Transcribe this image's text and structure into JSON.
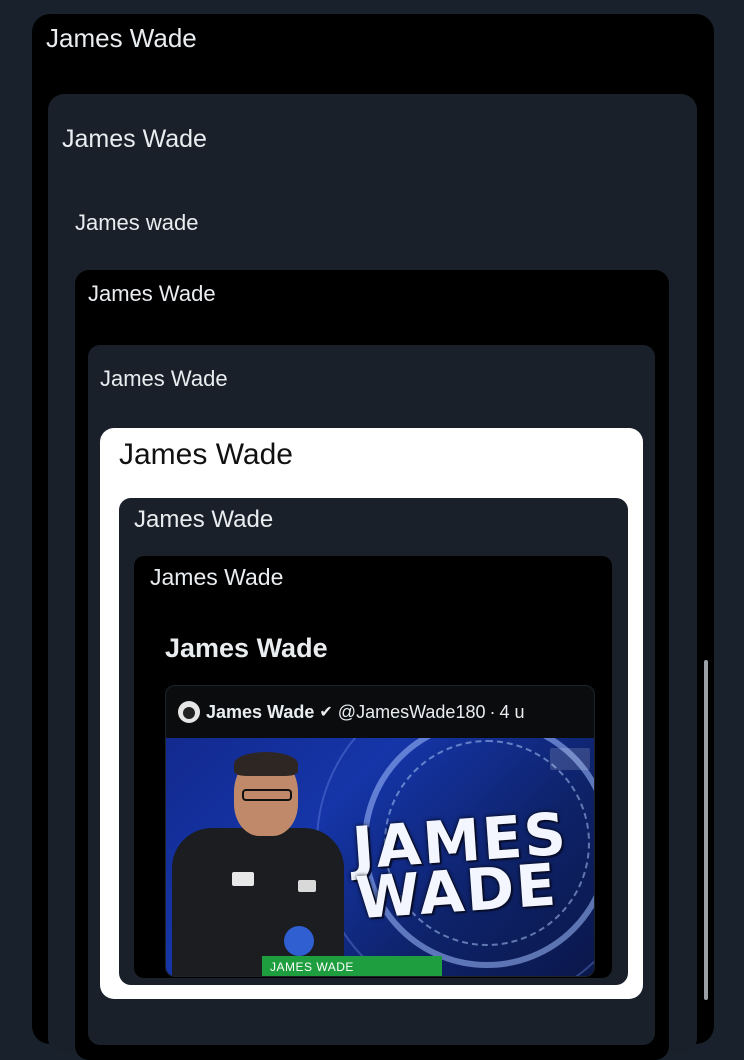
{
  "thread": {
    "level1": {
      "name": "James Wade"
    },
    "level2": {
      "name": "James Wade",
      "text": "James wade"
    },
    "level3": {
      "name": "James Wade"
    },
    "level4": {
      "name": "James Wade"
    },
    "level5": {
      "name": "James Wade"
    },
    "level6": {
      "name": "James Wade"
    },
    "level7": {
      "name": "James Wade",
      "text": "James Wade"
    },
    "embedded_tweet": {
      "avatar_icon": "avatar",
      "display_name": "James Wade",
      "verified_icon": "verified-badge-icon",
      "verified_glyph": "✔",
      "handle": "@JamesWade180",
      "separator": "·",
      "time": "4 u",
      "media": {
        "logo_text": "JAMES\nWADE",
        "lower_third": "JAMES WADE"
      }
    }
  },
  "colors": {
    "page_bg": "#19222c",
    "dark_card": "#000000",
    "mid_card": "#192029",
    "white_card": "#ffffff",
    "lower_third_green": "#1e9e3e"
  }
}
